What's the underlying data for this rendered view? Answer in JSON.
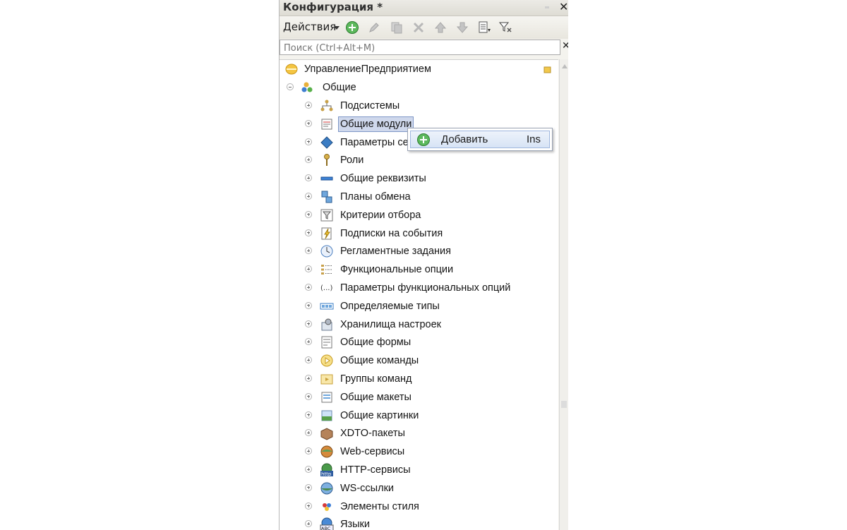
{
  "panel": {
    "title": "Конфигурация *",
    "close_glyph": "✕"
  },
  "toolbar": {
    "actions_label": "Действия",
    "buttons": [
      "add-icon",
      "edit-icon",
      "copy-icon",
      "delete-icon",
      "move-up-icon",
      "move-down-icon",
      "sort-icon",
      "filter-icon"
    ]
  },
  "search": {
    "placeholder": "Поиск (Ctrl+Alt+M)",
    "clear_glyph": "✕"
  },
  "tree": {
    "root_label": "УправлениеПредприятием",
    "general_label": "Общие",
    "items": [
      {
        "label": "Подсистемы",
        "icon": "subsystems-icon"
      },
      {
        "label": "Общие модули",
        "icon": "common-modules-icon"
      },
      {
        "label": "Параметры се",
        "icon": "session-params-icon"
      },
      {
        "label": "Роли",
        "icon": "roles-icon"
      },
      {
        "label": "Общие реквизиты",
        "icon": "common-attributes-icon"
      },
      {
        "label": "Планы обмена",
        "icon": "exchange-plans-icon"
      },
      {
        "label": "Критерии отбора",
        "icon": "filter-criteria-icon"
      },
      {
        "label": "Подписки на события",
        "icon": "event-subscriptions-icon"
      },
      {
        "label": "Регламентные задания",
        "icon": "scheduled-jobs-icon"
      },
      {
        "label": "Функциональные опции",
        "icon": "functional-options-icon"
      },
      {
        "label": "Параметры функциональных опций",
        "icon": "functional-options-params-icon"
      },
      {
        "label": "Определяемые типы",
        "icon": "defined-types-icon"
      },
      {
        "label": "Хранилища настроек",
        "icon": "settings-storages-icon"
      },
      {
        "label": "Общие формы",
        "icon": "common-forms-icon"
      },
      {
        "label": "Общие команды",
        "icon": "common-commands-icon"
      },
      {
        "label": "Группы команд",
        "icon": "command-groups-icon"
      },
      {
        "label": "Общие макеты",
        "icon": "common-templates-icon"
      },
      {
        "label": "Общие картинки",
        "icon": "common-pictures-icon"
      },
      {
        "label": "XDTO-пакеты",
        "icon": "xdto-packages-icon"
      },
      {
        "label": "Web-сервисы",
        "icon": "web-services-icon"
      },
      {
        "label": "HTTP-сервисы",
        "icon": "http-services-icon"
      },
      {
        "label": "WS-ссылки",
        "icon": "ws-references-icon"
      },
      {
        "label": "Элементы стиля",
        "icon": "style-items-icon"
      },
      {
        "label": "Языки",
        "icon": "languages-icon"
      }
    ],
    "selected_index": 1
  },
  "context_menu": {
    "item_label": "Добавить",
    "shortcut": "Ins"
  }
}
